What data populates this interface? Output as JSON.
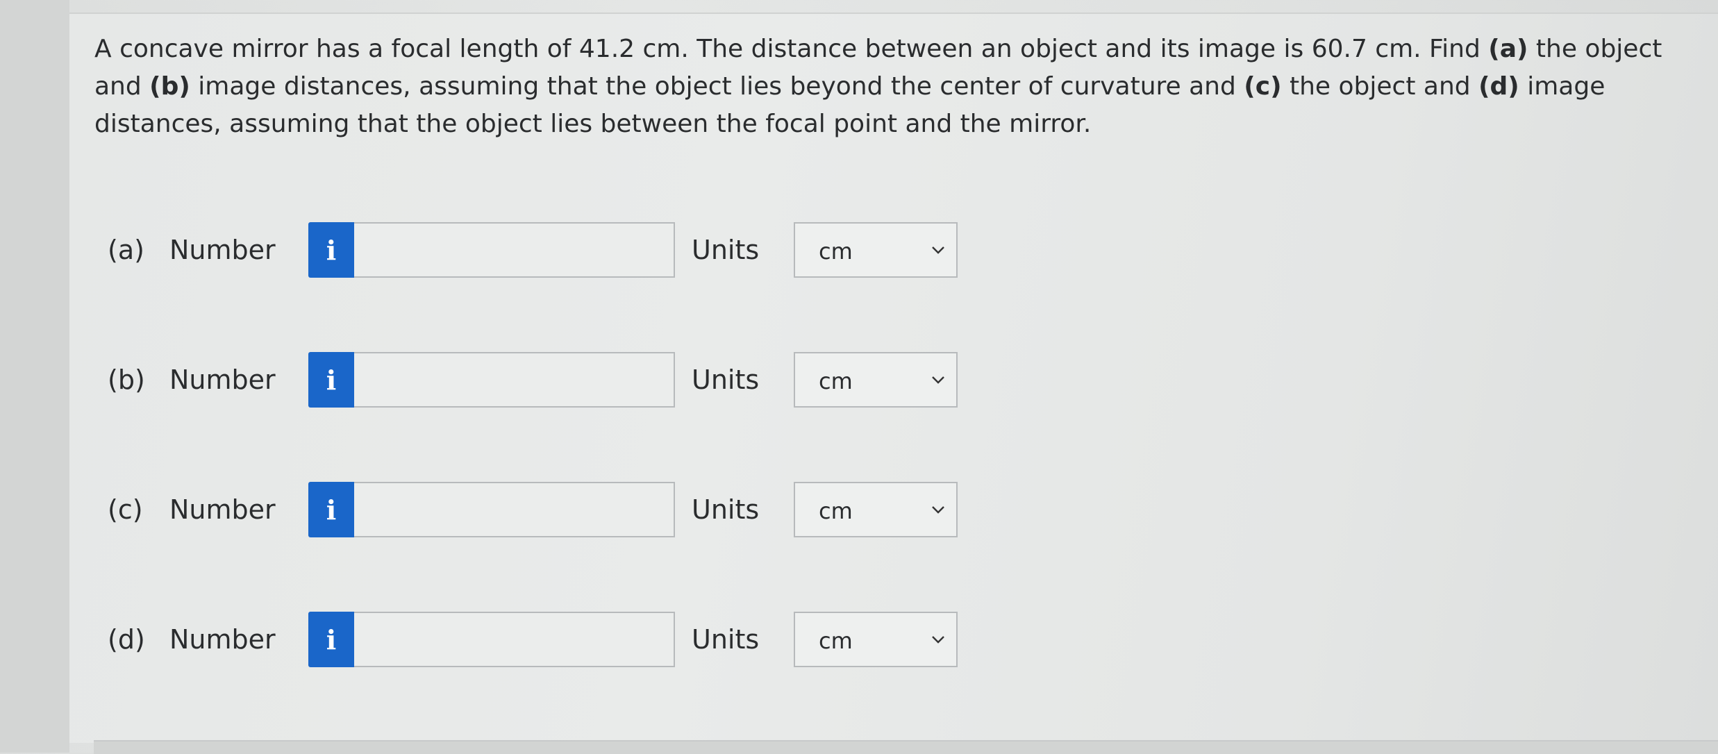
{
  "question": {
    "line1_pre": "A concave mirror has a focal length of 41.2 cm. The distance between an object and its image is 60.7 cm. Find ",
    "a_tag": "(a)",
    "mid1": " the object and ",
    "b_tag": "(b)",
    "mid2": " image distances, assuming that the object lies beyond the center of curvature and ",
    "c_tag": "(c)",
    "mid3": " the object and ",
    "d_tag": "(d)",
    "mid4": " image distances, assuming that the object lies between the focal point and the mirror."
  },
  "parts": [
    {
      "label": "(a)",
      "number_label": "Number",
      "info_icon": "i",
      "value": "",
      "units_label": "Units",
      "unit": "cm"
    },
    {
      "label": "(b)",
      "number_label": "Number",
      "info_icon": "i",
      "value": "",
      "units_label": "Units",
      "unit": "cm"
    },
    {
      "label": "(c)",
      "number_label": "Number",
      "info_icon": "i",
      "value": "",
      "units_label": "Units",
      "unit": "cm"
    },
    {
      "label": "(d)",
      "number_label": "Number",
      "info_icon": "i",
      "value": "",
      "units_label": "Units",
      "unit": "cm"
    }
  ],
  "colors": {
    "info_button": "#1a66c9"
  }
}
